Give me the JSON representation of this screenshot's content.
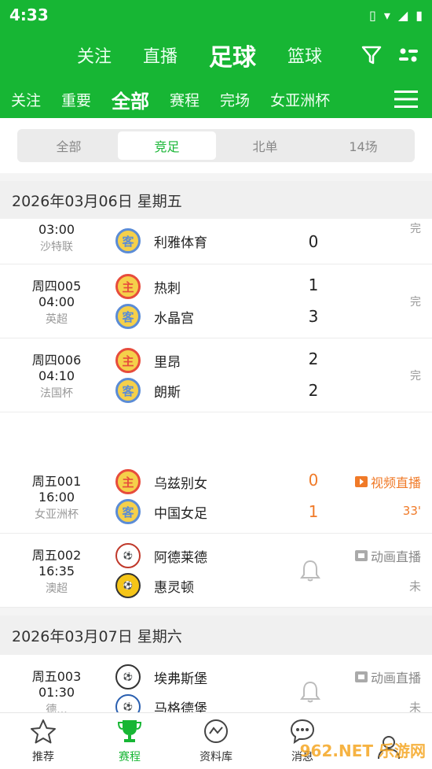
{
  "status_bar": {
    "time": "4:33"
  },
  "top_tabs": [
    "关注",
    "直播",
    "足球",
    "篮球"
  ],
  "top_active": 2,
  "sub_tabs": [
    "关注",
    "重要",
    "全部",
    "赛程",
    "完场",
    "女亚洲杯"
  ],
  "sub_active": 2,
  "segments": [
    "全部",
    "竞足",
    "北单",
    "14场"
  ],
  "segment_active": 1,
  "dates": [
    "2026年03月06日  星期五",
    "2026年03月07日  星期六"
  ],
  "matches": [
    {
      "code": "",
      "time": "03:00",
      "league": "沙特联",
      "home": "",
      "away": "利雅体育",
      "home_score": "",
      "away_score": "0",
      "status": "完"
    },
    {
      "code": "周四005",
      "time": "04:00",
      "league": "英超",
      "home": "热刺",
      "away": "水晶宫",
      "home_score": "1",
      "away_score": "3",
      "status": "完"
    },
    {
      "code": "周四006",
      "time": "04:10",
      "league": "法国杯",
      "home": "里昂",
      "away": "朗斯",
      "home_score": "2",
      "away_score": "2",
      "status": "完"
    },
    {
      "code": "周五001",
      "time": "16:00",
      "league": "女亚洲杯",
      "home": "乌兹别女",
      "away": "中国女足",
      "home_score": "0",
      "away_score": "1",
      "status": "视频直播",
      "minute": "33'"
    },
    {
      "code": "周五002",
      "time": "16:35",
      "league": "澳超",
      "home": "阿德莱德",
      "away": "惠灵顿",
      "status": "动画直播",
      "state": "未"
    },
    {
      "code": "周五003",
      "time": "01:30",
      "league": "德...",
      "home": "埃弗斯堡",
      "away": "马格德堡",
      "status": "动画直播",
      "state": "未"
    }
  ],
  "badges": {
    "home": "主",
    "away": "客"
  },
  "bottom_nav": [
    "推荐",
    "赛程",
    "资料库",
    "消息",
    ""
  ],
  "bottom_active": 1,
  "watermark": "962.NET 乐游网"
}
